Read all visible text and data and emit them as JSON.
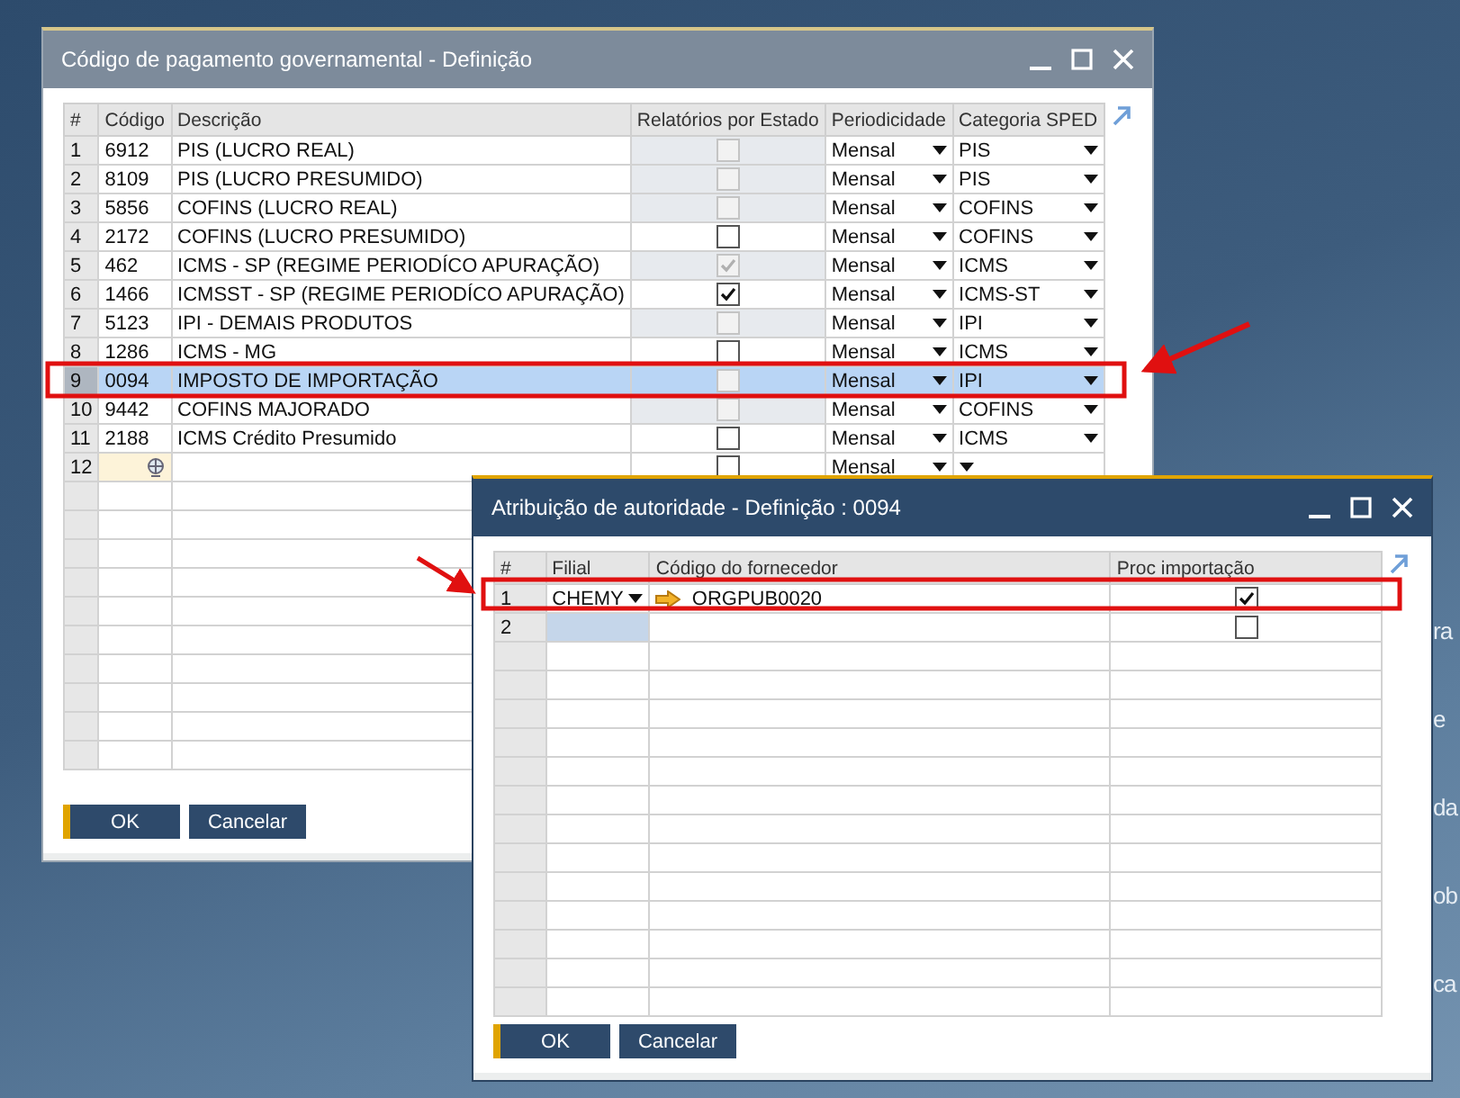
{
  "main_window": {
    "title": "Código de pagamento governamental - Definição",
    "columns": [
      "#",
      "Código",
      "Descrição",
      "Relatórios por Estado",
      "Periodicidade",
      "Categoria SPED"
    ],
    "rows": [
      {
        "num": "1",
        "code": "6912",
        "description": "PIS (LUCRO REAL)",
        "report_by_state": {
          "checked": false,
          "disabled": true
        },
        "periodicity": "Mensal",
        "sped_category": "PIS",
        "selected": false,
        "editing": false
      },
      {
        "num": "2",
        "code": "8109",
        "description": "PIS (LUCRO PRESUMIDO)",
        "report_by_state": {
          "checked": false,
          "disabled": true
        },
        "periodicity": "Mensal",
        "sped_category": "PIS",
        "selected": false,
        "editing": false
      },
      {
        "num": "3",
        "code": "5856",
        "description": "COFINS (LUCRO REAL)",
        "report_by_state": {
          "checked": false,
          "disabled": true
        },
        "periodicity": "Mensal",
        "sped_category": "COFINS",
        "selected": false,
        "editing": false
      },
      {
        "num": "4",
        "code": "2172",
        "description": "COFINS (LUCRO PRESUMIDO)",
        "report_by_state": {
          "checked": false,
          "disabled": false
        },
        "periodicity": "Mensal",
        "sped_category": "COFINS",
        "selected": false,
        "editing": false
      },
      {
        "num": "5",
        "code": "462",
        "description": "ICMS - SP (REGIME PERIODÍCO APURAÇÃO)",
        "report_by_state": {
          "checked": true,
          "disabled": true
        },
        "periodicity": "Mensal",
        "sped_category": "ICMS",
        "selected": false,
        "editing": false
      },
      {
        "num": "6",
        "code": "1466",
        "description": "ICMSST - SP (REGIME PERIODÍCO APURAÇÃO)",
        "report_by_state": {
          "checked": true,
          "disabled": false
        },
        "periodicity": "Mensal",
        "sped_category": "ICMS-ST",
        "selected": false,
        "editing": false
      },
      {
        "num": "7",
        "code": "5123",
        "description": "IPI - DEMAIS PRODUTOS",
        "report_by_state": {
          "checked": false,
          "disabled": true
        },
        "periodicity": "Mensal",
        "sped_category": "IPI",
        "selected": false,
        "editing": false
      },
      {
        "num": "8",
        "code": "1286",
        "description": "ICMS - MG",
        "report_by_state": {
          "checked": false,
          "disabled": false
        },
        "periodicity": "Mensal",
        "sped_category": "ICMS",
        "selected": false,
        "editing": false
      },
      {
        "num": "9",
        "code": "0094",
        "description": "IMPOSTO DE IMPORTAÇÃO",
        "report_by_state": {
          "checked": false,
          "disabled": true
        },
        "periodicity": "Mensal",
        "sped_category": "IPI",
        "selected": true,
        "editing": false
      },
      {
        "num": "10",
        "code": "9442",
        "description": "COFINS MAJORADO",
        "report_by_state": {
          "checked": false,
          "disabled": true
        },
        "periodicity": "Mensal",
        "sped_category": "COFINS",
        "selected": false,
        "editing": false
      },
      {
        "num": "11",
        "code": "2188",
        "description": "ICMS Crédito Presumido",
        "report_by_state": {
          "checked": false,
          "disabled": false
        },
        "periodicity": "Mensal",
        "sped_category": "ICMS",
        "selected": false,
        "editing": false
      },
      {
        "num": "12",
        "report_by_state": {
          "checked": false,
          "disabled": false
        },
        "periodicity": "Mensal",
        "selected": false,
        "editing": true
      }
    ],
    "buttons": [
      {
        "label": "OK",
        "default": true
      },
      {
        "label": "Cancelar",
        "default": false
      }
    ]
  },
  "assignment_window": {
    "title": "Atribuição de autoridade - Definição : 0094",
    "columns": [
      "#",
      "Filial",
      "Código do fornecedor",
      "Proc importação"
    ],
    "rows": [
      {
        "num": "1",
        "branch": "CHEMY",
        "vendor_code": "ORGPUB0020",
        "import_process": {
          "checked": true
        },
        "selected": false
      },
      {
        "num": "2",
        "import_process": {
          "checked": false
        },
        "selected": true
      }
    ],
    "buttons": [
      {
        "label": "OK",
        "default": true
      },
      {
        "label": "Cancelar",
        "default": false
      }
    ]
  },
  "background_text": [
    "ra",
    "e",
    "da",
    "ob",
    "ca"
  ]
}
